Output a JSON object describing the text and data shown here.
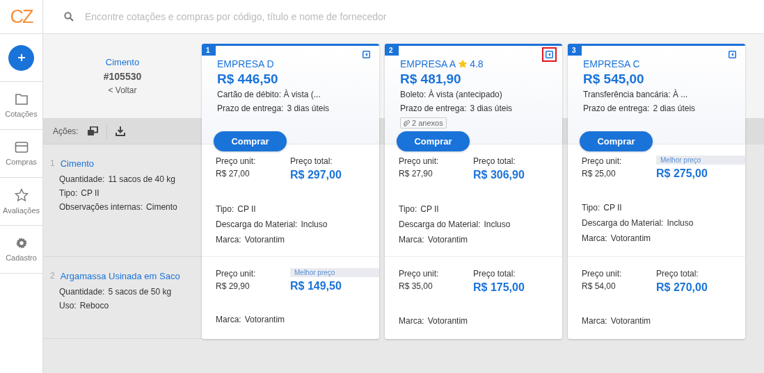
{
  "logo": "CZ",
  "search": {
    "placeholder": "Encontre cotações e compras por código, título e nome de fornecedor"
  },
  "sidebar": {
    "items": [
      {
        "label": "Cotações",
        "kind": "folder"
      },
      {
        "label": "Compras",
        "kind": "card"
      },
      {
        "label": "Avaliações",
        "kind": "star"
      },
      {
        "label": "Cadastro",
        "kind": "gear"
      }
    ]
  },
  "quote": {
    "title": "Cimento",
    "code": "#105530",
    "back": "< Voltar",
    "actions_label": "Ações:"
  },
  "items": [
    {
      "number": "1",
      "name": "Cimento",
      "fields": [
        {
          "label": "Quantidade:",
          "value": "11 sacos de 40 kg"
        },
        {
          "label": "Tipo:",
          "value": "CP II"
        },
        {
          "label": "Observações internas:",
          "value": "Cimento"
        }
      ]
    },
    {
      "number": "2",
      "name": "Argamassa Usinada em Saco",
      "fields": [
        {
          "label": "Quantidade:",
          "value": "5 sacos de 50 kg"
        },
        {
          "label": "Uso:",
          "value": "Reboco"
        }
      ]
    }
  ],
  "proposals": [
    {
      "rank": "1",
      "supplier": "EMPRESA D",
      "highlighted": false,
      "total": "R$ 446,50",
      "payment": "Cartão de débito: À vista (...",
      "delivery_label": "Prazo de entrega:",
      "delivery": "3 dias úteis",
      "button": "Comprar",
      "items": [
        {
          "unit_label": "Preço unit:",
          "unit_price": "R$ 27,00",
          "total_label": "Preço total:",
          "best_price": false,
          "total": "R$ 297,00",
          "fields": [
            {
              "label": "Tipo:",
              "value": "CP II"
            },
            {
              "label": "Descarga do Material:",
              "value": "Incluso"
            },
            {
              "label": "Marca:",
              "value": "Votorantim"
            }
          ]
        },
        {
          "unit_label": "Preço unit:",
          "unit_price": "R$ 29,90",
          "total_label": "Melhor preço",
          "best_price": true,
          "total": "R$ 149,50",
          "fields": [
            {
              "label": "Marca:",
              "value": "Votorantim"
            }
          ]
        }
      ]
    },
    {
      "rank": "2",
      "supplier": "EMPRESA A",
      "rating": "4.8",
      "highlighted": true,
      "total": "R$ 481,90",
      "payment": "Boleto: À vista (antecipado)",
      "delivery_label": "Prazo de entrega:",
      "delivery": "3 dias úteis",
      "attachments": "2 anexos",
      "button": "Comprar",
      "items": [
        {
          "unit_label": "Preço unit:",
          "unit_price": "R$ 27,90",
          "total_label": "Preço total:",
          "best_price": false,
          "total": "R$ 306,90",
          "fields": [
            {
              "label": "Tipo:",
              "value": "CP II"
            },
            {
              "label": "Descarga do Material:",
              "value": "Incluso"
            },
            {
              "label": "Marca:",
              "value": "Votorantim"
            }
          ]
        },
        {
          "unit_label": "Preço unit:",
          "unit_price": "R$ 35,00",
          "total_label": "Preço total:",
          "best_price": false,
          "total": "R$ 175,00",
          "fields": [
            {
              "label": "Marca:",
              "value": "Votorantim"
            }
          ]
        }
      ]
    },
    {
      "rank": "3",
      "supplier": "EMPRESA C",
      "highlighted": false,
      "total": "R$ 545,00",
      "payment": "Transferência bancária: À ...",
      "delivery_label": "Prazo de entrega:",
      "delivery": "2 dias úteis",
      "button": "Comprar",
      "items": [
        {
          "unit_label": "Preço unit:",
          "unit_price": "R$ 25,00",
          "total_label": "Melhor preço",
          "best_price": true,
          "total": "R$ 275,00",
          "fields": [
            {
              "label": "Tipo:",
              "value": "CP II"
            },
            {
              "label": "Descarga do Material:",
              "value": "Incluso"
            },
            {
              "label": "Marca:",
              "value": "Votorantim"
            }
          ]
        },
        {
          "unit_label": "Preço unit:",
          "unit_price": "R$ 54,00",
          "total_label": "Preço total:",
          "best_price": false,
          "total": "R$ 270,00",
          "fields": [
            {
              "label": "Marca:",
              "value": "Votorantim"
            }
          ]
        }
      ]
    }
  ]
}
